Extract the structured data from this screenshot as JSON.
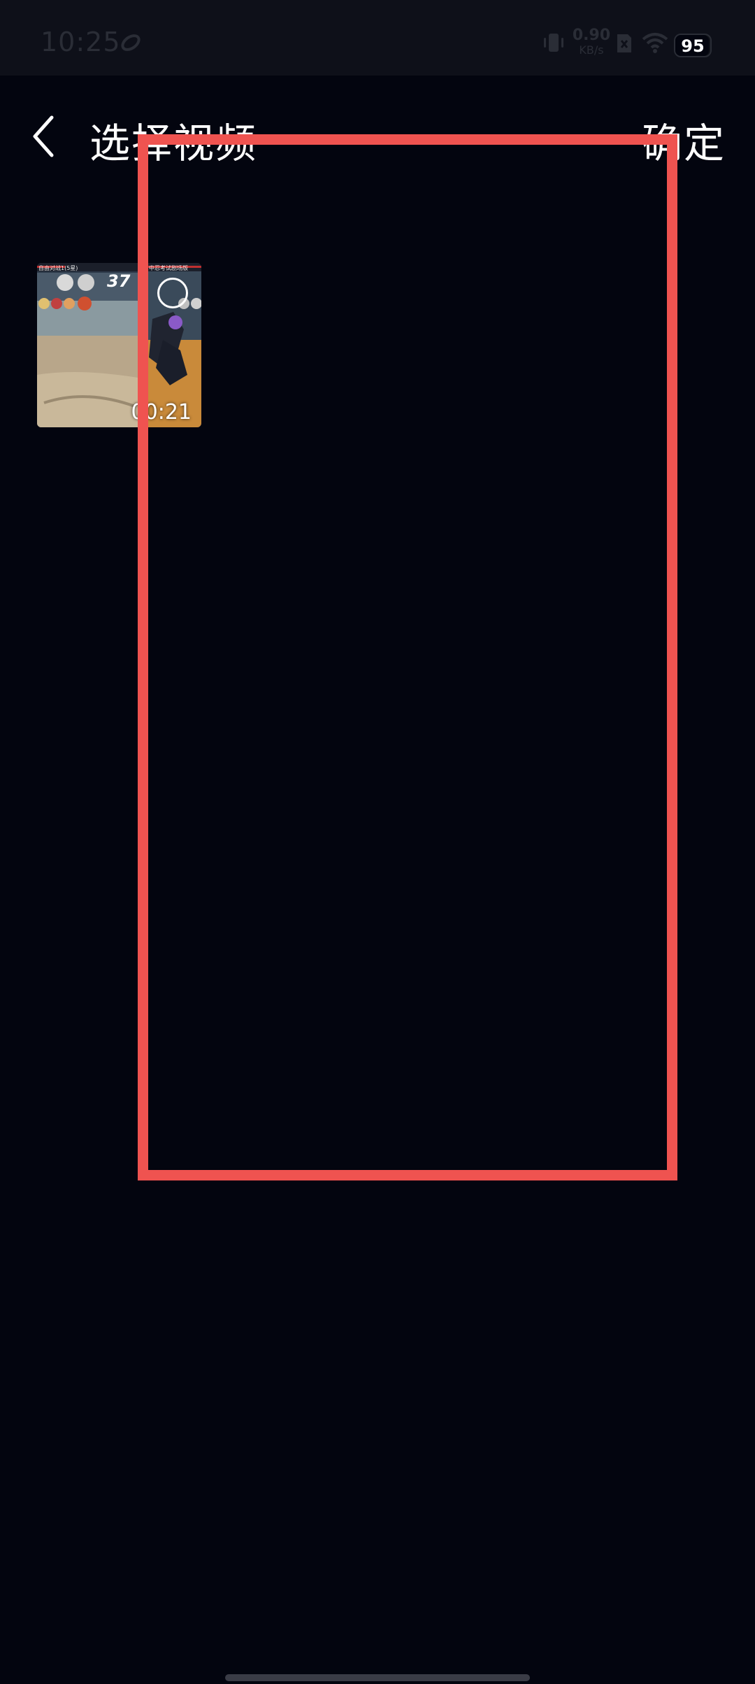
{
  "status_bar": {
    "time": "10:25",
    "net_speed_value": "0.90",
    "net_speed_unit": "KB/s",
    "battery_level": "95",
    "battery_fraction": 0.95,
    "icons": [
      "sync-icon",
      "vibrate-icon",
      "sim-icon",
      "wifi-icon",
      "battery-icon"
    ]
  },
  "header": {
    "title": "选择视频",
    "confirm_label": "确定",
    "back_icon": "chevron-left-icon"
  },
  "videos": [
    {
      "duration": "00:21",
      "thumb_hud_left": "自由对战1(5星)",
      "thumb_hud_right": "中忍考试剧场版",
      "thumb_score": "37",
      "selected": false
    }
  ],
  "colors": {
    "background": "#03050f",
    "status_bar_bg": "#0e1019",
    "highlight": "#ef5350",
    "text": "#ffffff"
  }
}
